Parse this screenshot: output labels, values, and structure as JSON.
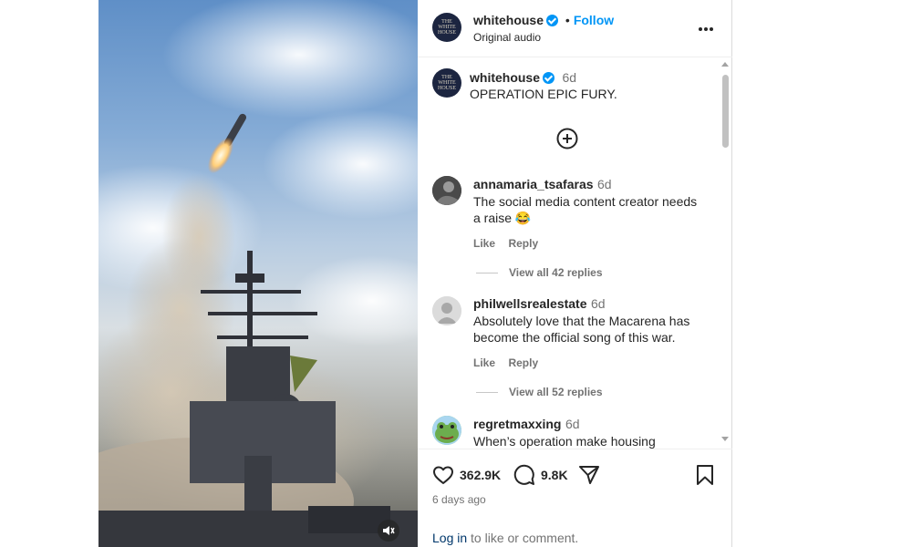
{
  "post": {
    "username": "whitehouse",
    "follow_label": "Follow",
    "separator": "•",
    "audio": "Original audio",
    "avatar_text": "THE\nWHITE\nHOUSE"
  },
  "caption": {
    "username": "whitehouse",
    "time": "6d",
    "text": "OPERATION EPIC FURY."
  },
  "comments": [
    {
      "username": "annamaria_tsafaras",
      "time": "6d",
      "text_line1": "The social media content creator needs",
      "text_line2": "a raise 😂",
      "like": "Like",
      "reply": "Reply",
      "replies": "View all 42 replies"
    },
    {
      "username": "philwellsrealestate",
      "time": "6d",
      "text_line1": "Absolutely love that the Macarena has",
      "text_line2": "become the official song of this war.",
      "like": "Like",
      "reply": "Reply",
      "replies": "View all 52 replies"
    },
    {
      "username": "regretmaxxing",
      "time": "6d",
      "text_line1": "When’s operation make housing"
    }
  ],
  "footer": {
    "likes": "362.9K",
    "comments": "9.8K",
    "posted": "6 days ago",
    "login_link": "Log in",
    "login_rest": " to like or comment."
  },
  "icons": {
    "like": "heart-icon",
    "comment": "comment-icon",
    "share": "share-icon",
    "save": "bookmark-icon",
    "mute": "mute-icon",
    "more": "more-icon",
    "add": "add-comment-icon"
  },
  "colors": {
    "accent": "#0095f6",
    "muted": "#737373"
  }
}
